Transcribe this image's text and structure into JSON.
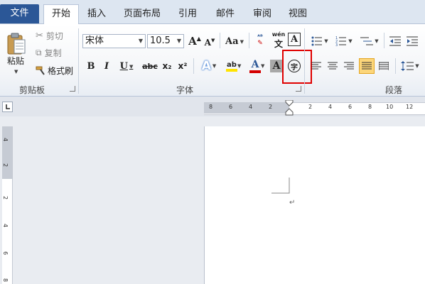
{
  "tabs": [
    {
      "label": "文件"
    },
    {
      "label": "开始"
    },
    {
      "label": "插入"
    },
    {
      "label": "页面布局"
    },
    {
      "label": "引用"
    },
    {
      "label": "邮件"
    },
    {
      "label": "审阅"
    },
    {
      "label": "视图"
    }
  ],
  "active_tab": "开始",
  "clipboard": {
    "paste_label": "粘贴",
    "cut_label": "剪切",
    "copy_label": "复制",
    "format_painter_label": "格式刷",
    "group_label": "剪贴板"
  },
  "font": {
    "font_name": "宋体",
    "font_size": "10.5",
    "group_label": "字体",
    "grow_glyph": "A",
    "shrink_glyph": "A",
    "case_glyph": "Aa",
    "bold_glyph": "B",
    "italic_glyph": "I",
    "underline_glyph": "U",
    "strike_glyph": "abc",
    "sub_glyph": "x₂",
    "sup_glyph": "x²",
    "effects_glyph": "A",
    "highlight_glyph": "ab",
    "color_glyph": "A",
    "shading_glyph": "A",
    "enclose_glyph": "字",
    "border_glyph": "A",
    "phonetic_glyph": "wén",
    "clear_glyph": "A"
  },
  "paragraph": {
    "group_label": "段落"
  },
  "ruler": {
    "h_numbers": [
      "8",
      "6",
      "4",
      "2",
      "2",
      "4",
      "6",
      "8",
      "10",
      "12"
    ],
    "v_numbers": [
      "4",
      "2",
      "2",
      "4",
      "6",
      "8"
    ]
  },
  "colors": {
    "highlight_box": "#e00000",
    "file_tab": "#2b5797",
    "font_color": "#d40000",
    "highlighter": "#ffe400"
  }
}
